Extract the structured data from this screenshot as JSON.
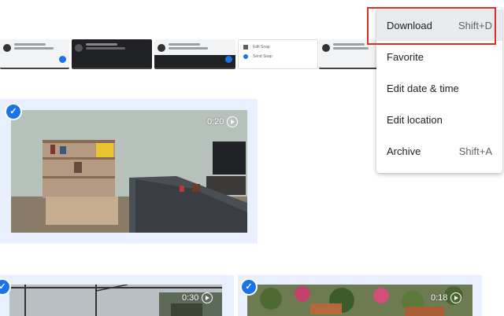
{
  "menu": {
    "items": [
      {
        "label": "Download",
        "shortcut": "Shift+D"
      },
      {
        "label": "Favorite",
        "shortcut": ""
      },
      {
        "label": "Edit date & time",
        "shortcut": ""
      },
      {
        "label": "Edit location",
        "shortcut": ""
      },
      {
        "label": "Archive",
        "shortcut": "Shift+A"
      }
    ]
  },
  "thumbnails": {
    "texts": [
      "Edit Snap",
      "Send Snap"
    ]
  },
  "videos": [
    {
      "duration": "0:20",
      "selected": true
    },
    {
      "duration": "0:30",
      "selected": true
    },
    {
      "duration": "0:18",
      "selected": true
    }
  ],
  "colors": {
    "accent": "#1a73e8",
    "selection_bg": "#e8f0fe",
    "highlight": "#d93025"
  }
}
